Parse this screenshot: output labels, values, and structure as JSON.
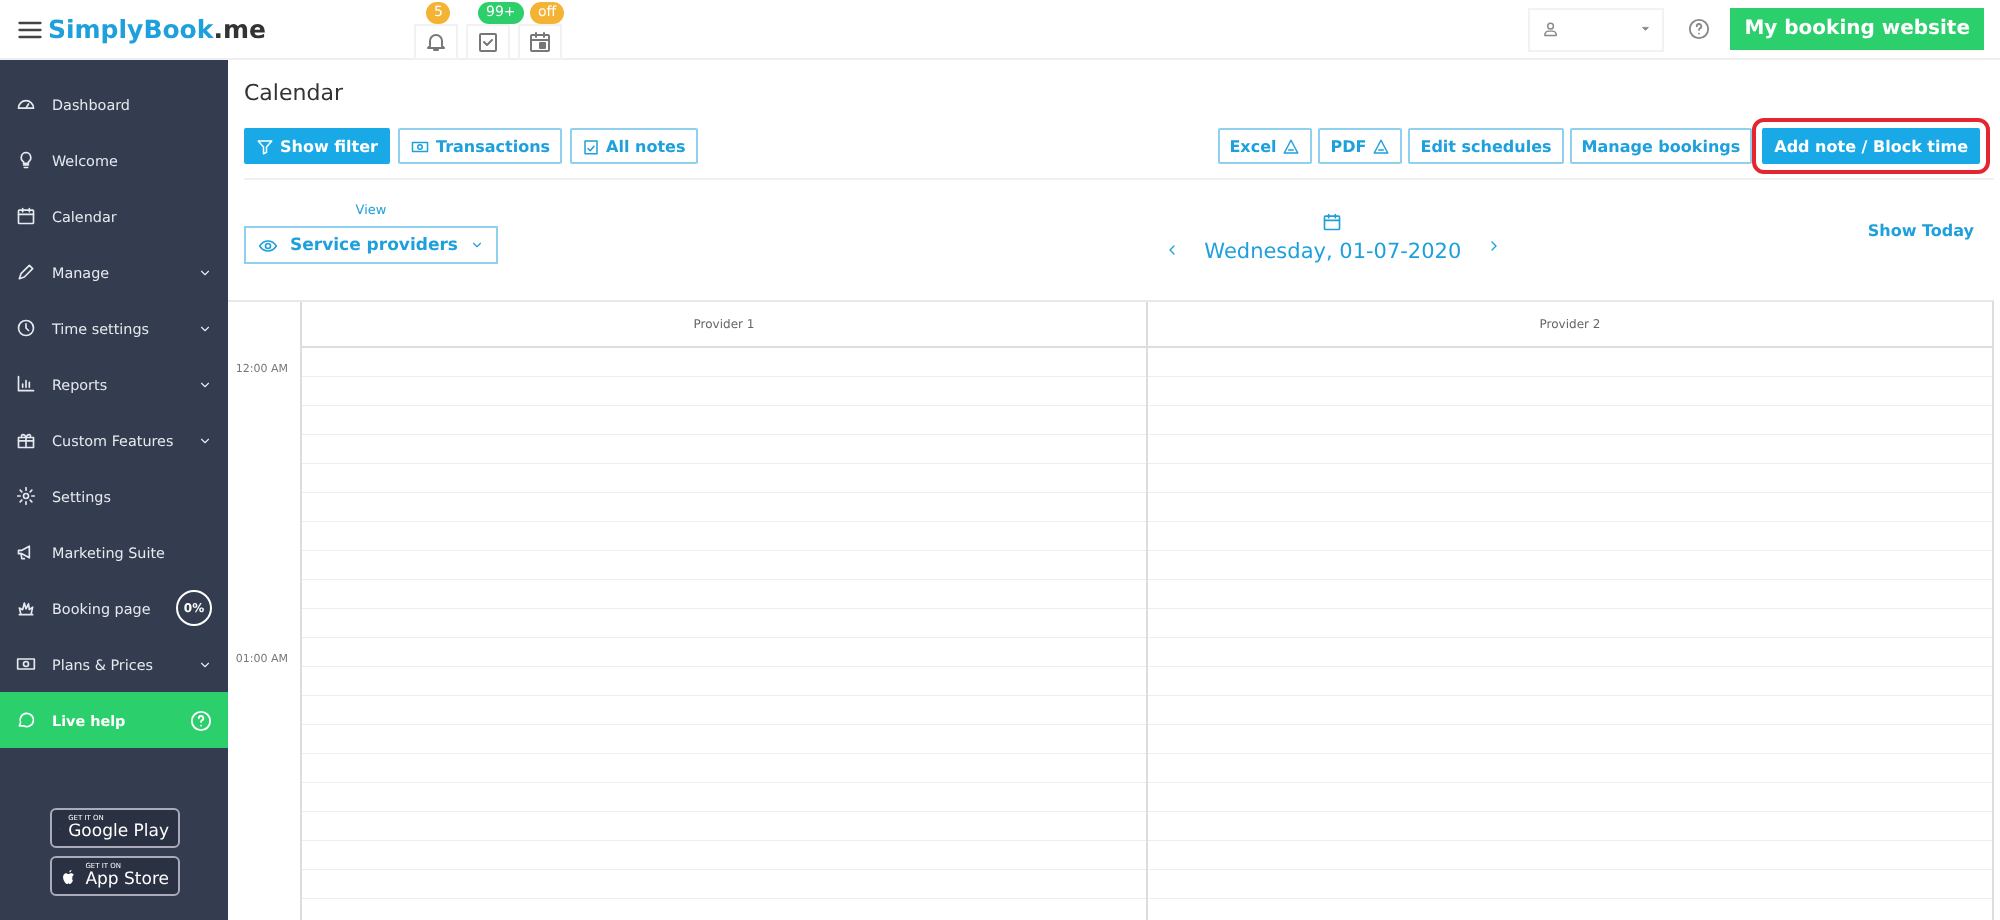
{
  "top_bar": {
    "logo": "SimplyBook",
    "logo_suffix": ".me",
    "badges": [
      {
        "kind": "bell",
        "count": "5",
        "color": "#f5b335"
      },
      {
        "kind": "tasks",
        "count": "99+",
        "color": "#2ccf6a"
      },
      {
        "kind": "calendar",
        "count": "off",
        "color": "#f5b335"
      }
    ],
    "website_button": "My booking website"
  },
  "sidebar": {
    "items": [
      {
        "label": "Dashboard",
        "expandable": false,
        "selected": false
      },
      {
        "label": "Welcome",
        "expandable": false,
        "selected": false
      },
      {
        "label": "Calendar",
        "expandable": false,
        "selected": false
      },
      {
        "label": "Manage",
        "expandable": true,
        "selected": false
      },
      {
        "label": "Time settings",
        "expandable": true,
        "selected": false
      },
      {
        "label": "Reports",
        "expandable": true,
        "selected": false
      },
      {
        "label": "Custom Features",
        "expandable": true,
        "selected": false
      },
      {
        "label": "Settings",
        "expandable": false,
        "selected": false
      },
      {
        "label": "Marketing Suite",
        "expandable": false,
        "selected": false
      },
      {
        "label": "Booking page",
        "expandable": false,
        "selected": false,
        "progress": "0%"
      },
      {
        "label": "Plans & Prices",
        "expandable": true,
        "selected": false
      }
    ],
    "live_help": "Live help",
    "stores": [
      {
        "kind": "google",
        "caption": "GET IT ON",
        "name": "Google Play"
      },
      {
        "kind": "apple",
        "caption": "GET IT ON",
        "name": "App Store"
      }
    ]
  },
  "page": {
    "title": "Calendar",
    "left_buttons": [
      {
        "kind": "filter",
        "label": "Show filter",
        "primary": true
      },
      {
        "kind": "money",
        "label": "Transactions",
        "primary": false
      },
      {
        "kind": "notes",
        "label": "All notes",
        "primary": false
      }
    ],
    "right_buttons": [
      {
        "kind": "export",
        "label": "Excel",
        "primary": false,
        "highlighted": false
      },
      {
        "kind": "export",
        "label": "PDF",
        "primary": false,
        "highlighted": false
      },
      {
        "kind": "plain",
        "label": "Edit schedules",
        "primary": false,
        "highlighted": false
      },
      {
        "kind": "plain",
        "label": "Manage bookings",
        "primary": false,
        "highlighted": false
      },
      {
        "kind": "plain",
        "label": "Add note / Block time",
        "primary": true,
        "highlighted": true
      }
    ],
    "view_label": "View",
    "view_value": "Service providers",
    "date": "Wednesday, 01-07-2020",
    "show_today": "Show Today",
    "columns": [
      "Provider 1",
      "Provider 2"
    ],
    "times": [
      "12:00 AM",
      "01:00 AM"
    ]
  }
}
